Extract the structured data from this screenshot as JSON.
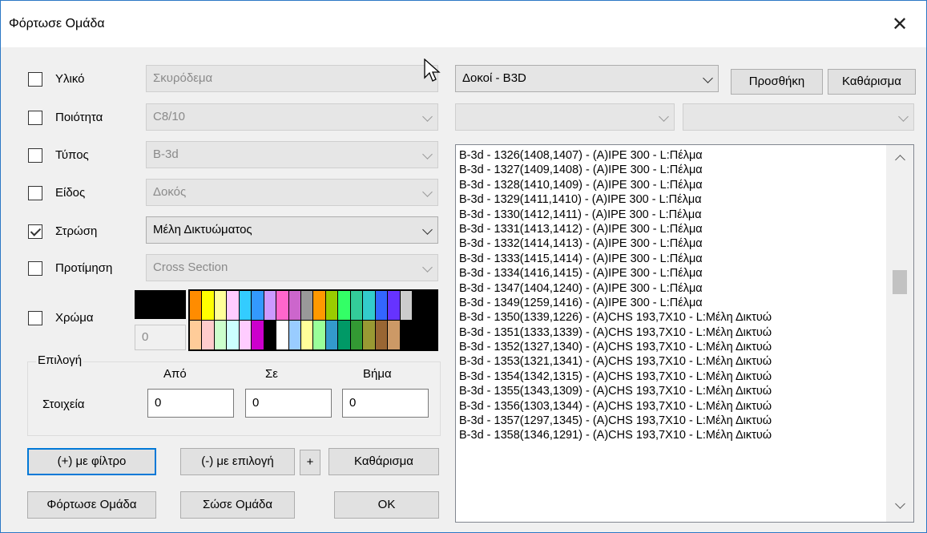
{
  "window": {
    "title": "Φόρτωσε Ομάδα",
    "close_symbol": "✕"
  },
  "filters": [
    {
      "label": "Υλικό",
      "value": "Σκυρόδεμα",
      "checked": false,
      "enabled": false
    },
    {
      "label": "Ποιότητα",
      "value": "C8/10",
      "checked": false,
      "enabled": false
    },
    {
      "label": "Τύπος",
      "value": "B-3d",
      "checked": false,
      "enabled": false
    },
    {
      "label": "Είδος",
      "value": "Δοκός",
      "checked": false,
      "enabled": false
    },
    {
      "label": "Στρώση",
      "value": "Μέλη Δικτυώματος",
      "checked": true,
      "enabled": true
    },
    {
      "label": "Προτίμηση",
      "value": "Cross Section",
      "checked": false,
      "enabled": false
    }
  ],
  "color": {
    "label": "Χρώμα",
    "checked": false,
    "selected_color": "#000000",
    "index_value": "0",
    "palette_row1": [
      "#ff8c00",
      "#ffff00",
      "#ffff99",
      "#ffccff",
      "#33ccff",
      "#3399ff",
      "#cc99ff",
      "#ff66cc",
      "#cc66cc",
      "#999999",
      "#ff9900",
      "#99cc00",
      "#33ff66",
      "#33cc99",
      "#33cccc",
      "#3366ff",
      "#6633ff",
      "#cccccc",
      "#000000",
      "#000000"
    ],
    "palette_row2": [
      "#ffcc99",
      "#ffcccc",
      "#ccffcc",
      "#ccffff",
      "#ffccff",
      "#cc00cc",
      "#000000",
      "#ffffff",
      "#99ccff",
      "#ffff99",
      "#99ff99",
      "#3399cc",
      "#009966",
      "#339933",
      "#999933",
      "#996633",
      "#cc9966",
      "#000000",
      "#000000",
      "#000000"
    ]
  },
  "selection": {
    "group_title": "Επιλογή",
    "row_label": "Στοιχεία",
    "from_label": "Από",
    "to_label": "Σε",
    "step_label": "Βήμα",
    "from_value": "0",
    "to_value": "0",
    "step_value": "0"
  },
  "buttons": {
    "with_filter": "(+) με φίλτρο",
    "with_selection": "(-) με επιλογή",
    "plus": "+",
    "clear_left": "Καθάρισμα",
    "load_group": "Φόρτωσε Ομάδα",
    "save_group": "Σώσε Ομάδα",
    "ok": "OK",
    "add": "Προσθήκη",
    "clear_right": "Καθάρισμα"
  },
  "right": {
    "group_combo_value": "Δοκοί - B3D",
    "sub_combo1_value": "",
    "sub_combo2_value": "",
    "list_items": [
      "B-3d - 1326(1408,1407) - (A)IPE 300 - L:Πέλμα",
      "B-3d - 1327(1409,1408) - (A)IPE 300 - L:Πέλμα",
      "B-3d - 1328(1410,1409) - (A)IPE 300 - L:Πέλμα",
      "B-3d - 1329(1411,1410) - (A)IPE 300 - L:Πέλμα",
      "B-3d - 1330(1412,1411) - (A)IPE 300 - L:Πέλμα",
      "B-3d - 1331(1413,1412) - (A)IPE 300 - L:Πέλμα",
      "B-3d - 1332(1414,1413) - (A)IPE 300 - L:Πέλμα",
      "B-3d - 1333(1415,1414) - (A)IPE 300 - L:Πέλμα",
      "B-3d - 1334(1416,1415) - (A)IPE 300 - L:Πέλμα",
      "B-3d - 1347(1404,1240) - (A)IPE 300 - L:Πέλμα",
      "B-3d - 1349(1259,1416) - (A)IPE 300 - L:Πέλμα",
      "B-3d - 1350(1339,1226) - (A)CHS 193,7X10 - L:Μέλη Δικτυώ",
      "B-3d - 1351(1333,1339) - (A)CHS 193,7X10 - L:Μέλη Δικτυώ",
      "B-3d - 1352(1327,1340) - (A)CHS 193,7X10 - L:Μέλη Δικτυώ",
      "B-3d - 1353(1321,1341) - (A)CHS 193,7X10 - L:Μέλη Δικτυώ",
      "B-3d - 1354(1342,1315) - (A)CHS 193,7X10 - L:Μέλη Δικτυώ",
      "B-3d - 1355(1343,1309) - (A)CHS 193,7X10 - L:Μέλη Δικτυώ",
      "B-3d - 1356(1303,1344) - (A)CHS 193,7X10 - L:Μέλη Δικτυώ",
      "B-3d - 1357(1297,1345) - (A)CHS 193,7X10 - L:Μέλη Δικτυώ",
      "B-3d - 1358(1346,1291) - (A)CHS 193,7X10 - L:Μέλη Δικτυώ"
    ]
  }
}
